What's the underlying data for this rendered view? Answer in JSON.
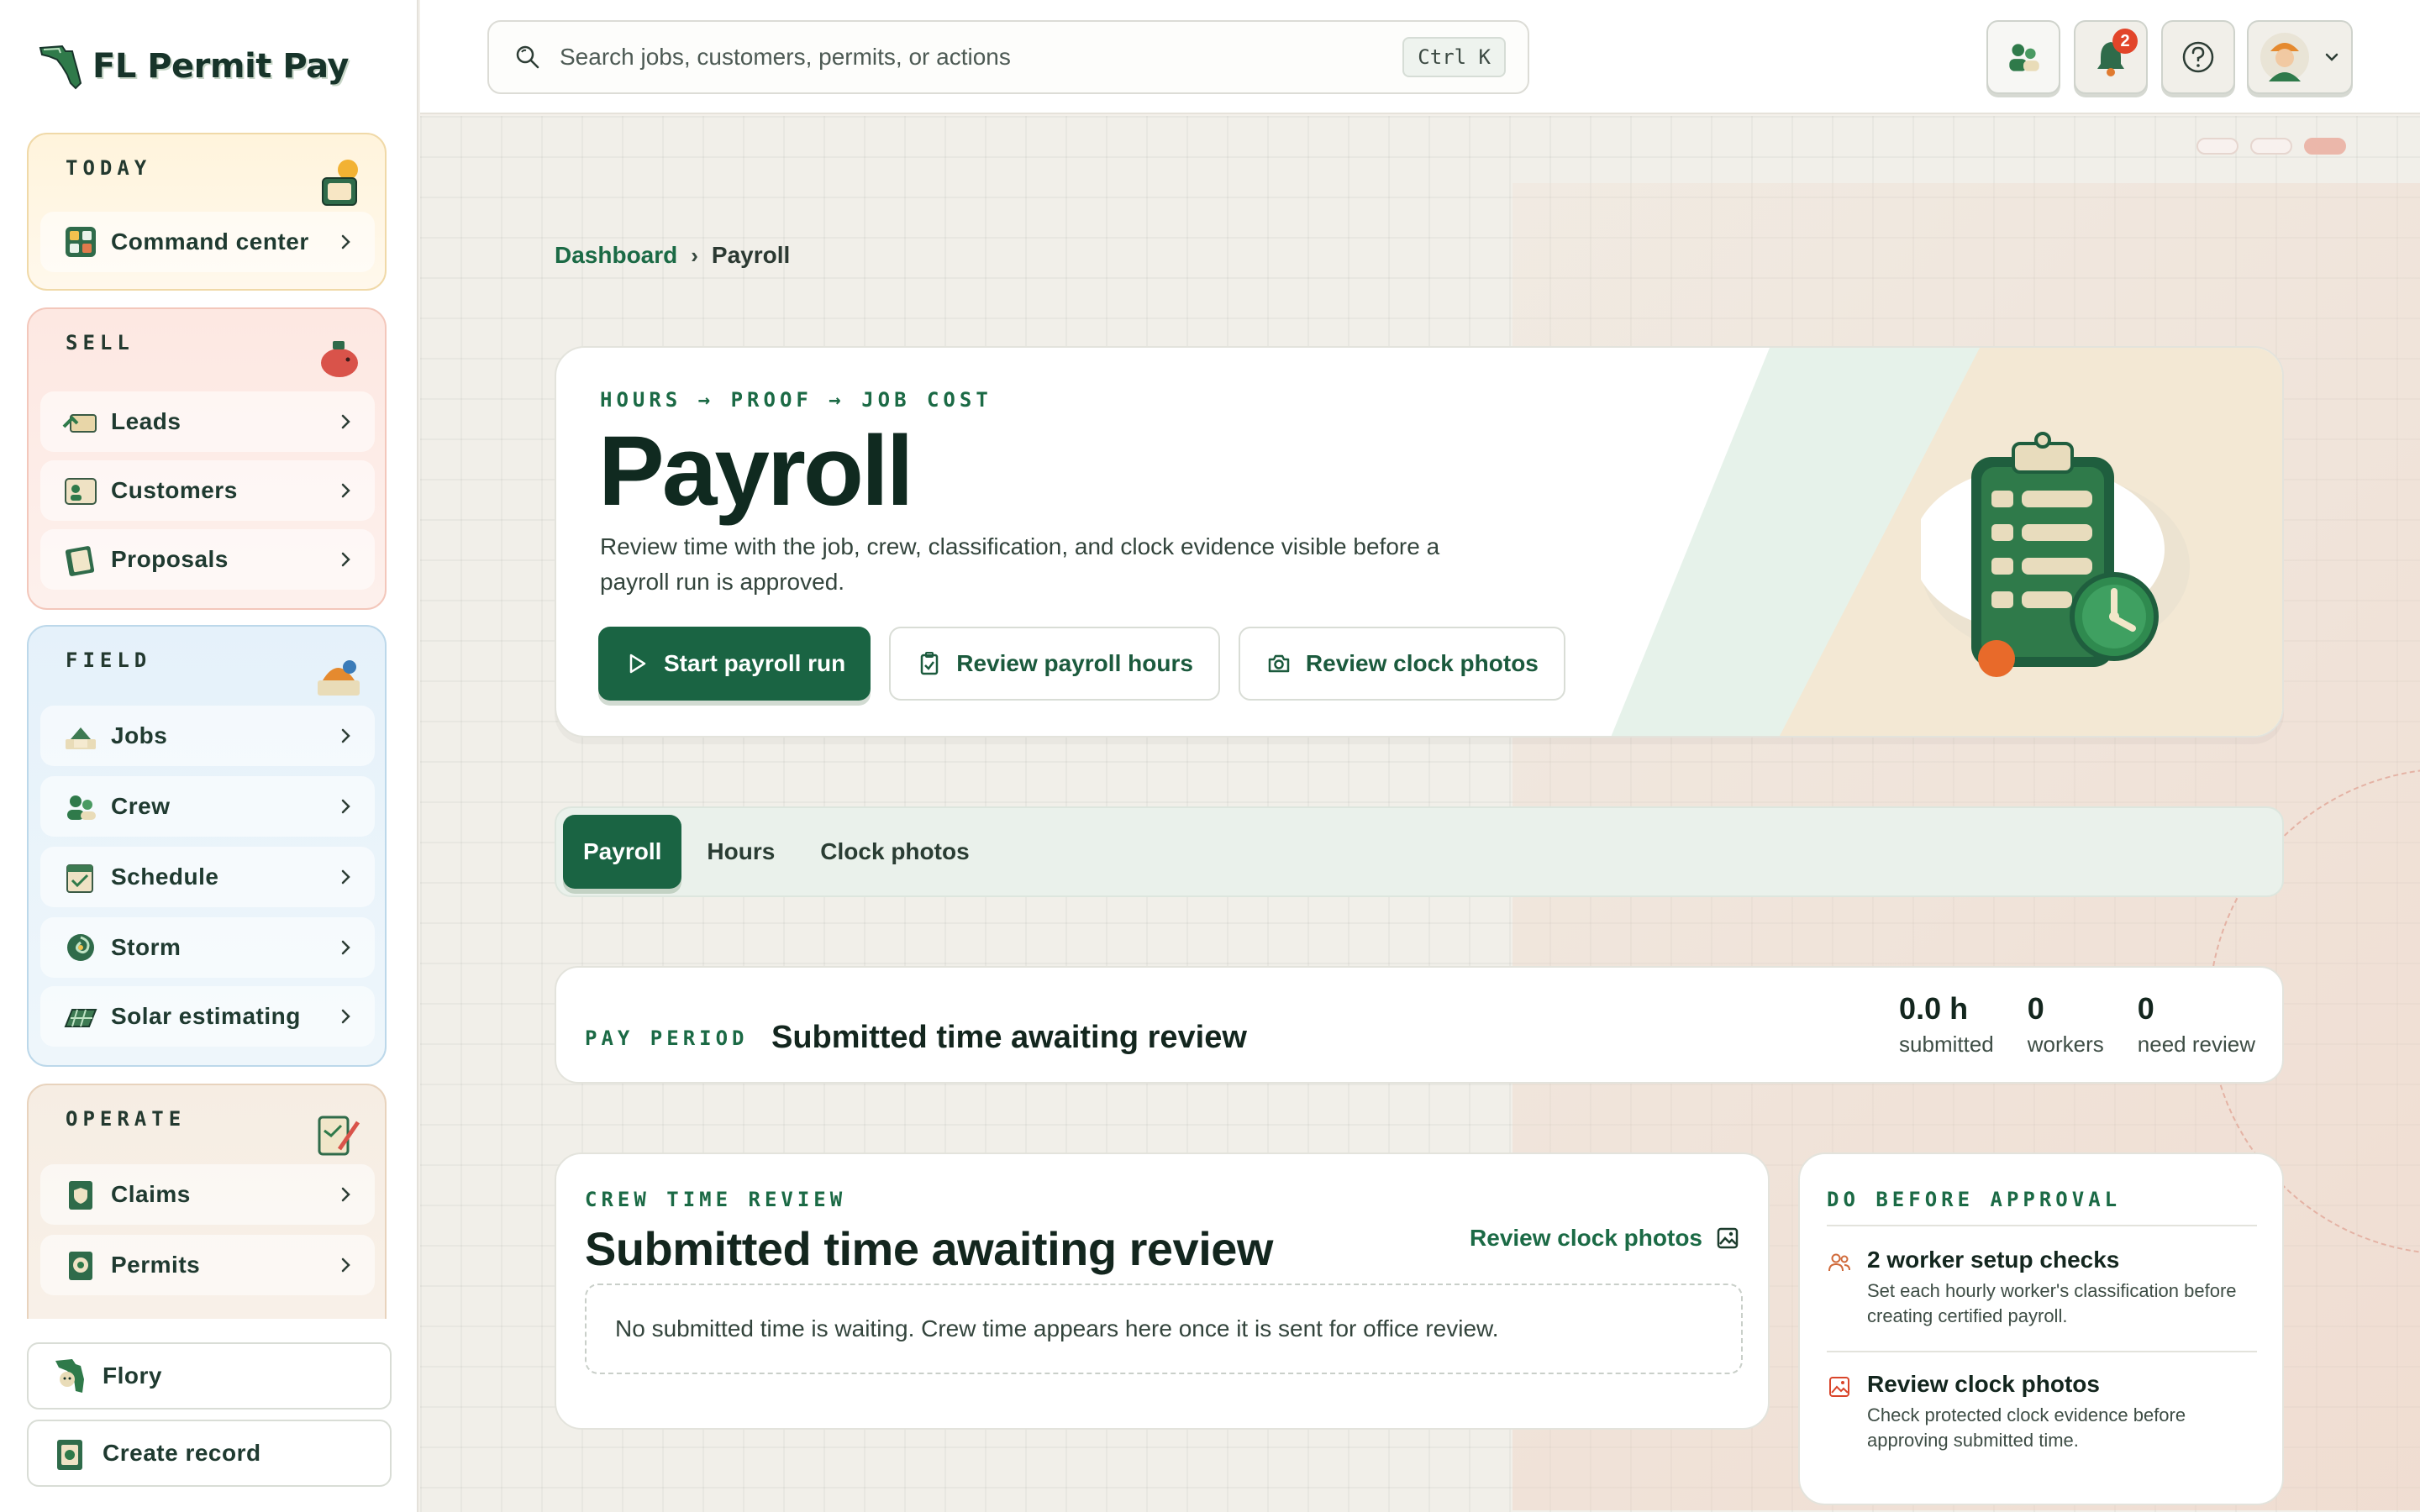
{
  "brand": {
    "name": "FL Permit Pay",
    "accent": "#1a6443"
  },
  "sidebar": {
    "groups": [
      {
        "title": "TODAY",
        "items": [
          {
            "label": "Command center"
          }
        ]
      },
      {
        "title": "SELL",
        "items": [
          {
            "label": "Leads"
          },
          {
            "label": "Customers"
          },
          {
            "label": "Proposals"
          }
        ]
      },
      {
        "title": "FIELD",
        "items": [
          {
            "label": "Jobs"
          },
          {
            "label": "Crew"
          },
          {
            "label": "Schedule"
          },
          {
            "label": "Storm"
          },
          {
            "label": "Solar estimating"
          }
        ]
      },
      {
        "title": "OPERATE",
        "items": [
          {
            "label": "Claims"
          },
          {
            "label": "Permits"
          }
        ]
      }
    ],
    "bottom": {
      "flory_label": "Flory",
      "create_label": "Create record"
    }
  },
  "topbar": {
    "search_placeholder": "Search jobs, customers, permits, or actions",
    "search_shortcut": "Ctrl K",
    "notification_count": "2"
  },
  "breadcrumb": {
    "parent": "Dashboard",
    "separator": "›",
    "current": "Payroll"
  },
  "hero": {
    "eyebrow": "HOURS → PROOF → JOB COST",
    "title": "Payroll",
    "description": "Review time with the job, crew, classification, and clock evidence visible before a payroll run is approved.",
    "actions": {
      "start": "Start payroll run",
      "hours": "Review payroll hours",
      "photos": "Review clock photos"
    }
  },
  "tabs": [
    {
      "label": "Payroll",
      "active": true
    },
    {
      "label": "Hours"
    },
    {
      "label": "Clock photos"
    }
  ],
  "period": {
    "eyebrow": "PAY PERIOD",
    "title": "Submitted time awaiting review",
    "stats": [
      {
        "value": "0.0 h",
        "label": "submitted"
      },
      {
        "value": "0",
        "label": "workers"
      },
      {
        "value": "0",
        "label": "need review"
      }
    ]
  },
  "crew_review": {
    "eyebrow": "CREW TIME REVIEW",
    "title": "Submitted time awaiting review",
    "link": "Review clock photos",
    "empty": "No submitted time is waiting. Crew time appears here once it is sent for office review."
  },
  "approval": {
    "eyebrow": "DO BEFORE APPROVAL",
    "items": [
      {
        "icon": "users-icon",
        "title": "2 worker setup checks",
        "desc": "Set each hourly worker's classification before creating certified payroll."
      },
      {
        "icon": "image-icon",
        "title": "Review clock photos",
        "desc": "Check protected clock evidence before approving submitted time."
      }
    ]
  }
}
